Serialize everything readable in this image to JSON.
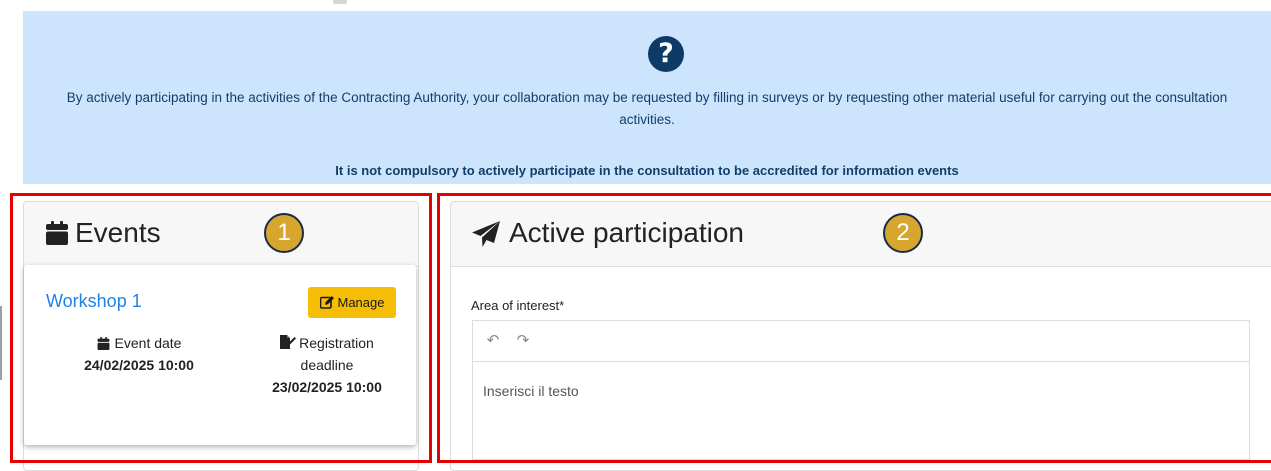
{
  "info": {
    "icon": "question-circle-icon",
    "message": "By actively participating in the activities of the Contracting Authority, your collaboration may be requested by filling in surveys or by requesting other material useful for carrying out the consultation activities.",
    "note": "It is not compulsory to actively participate in the consultation to be accredited for information events",
    "colors": {
      "background": "#cce5fd",
      "icon": "#0e3a68"
    }
  },
  "events": {
    "title": "Events",
    "icon": "calendar-icon",
    "badge": "1",
    "workshop": {
      "name": "Workshop 1",
      "manage_label": "Manage",
      "event_date_label": "Event date",
      "event_date": "24/02/2025 10:00",
      "registration_label": "Registration deadline",
      "registration_deadline": "23/02/2025 10:00"
    }
  },
  "active": {
    "title": "Active participation",
    "icon": "paper-plane-icon",
    "badge": "2",
    "field_label": "Area of interest*",
    "editor_placeholder": "Inserisci il testo"
  },
  "colors": {
    "highlight": "#e60000",
    "badge": "#d7a62f",
    "button": "#f5bd05",
    "link": "#1e82e6"
  }
}
